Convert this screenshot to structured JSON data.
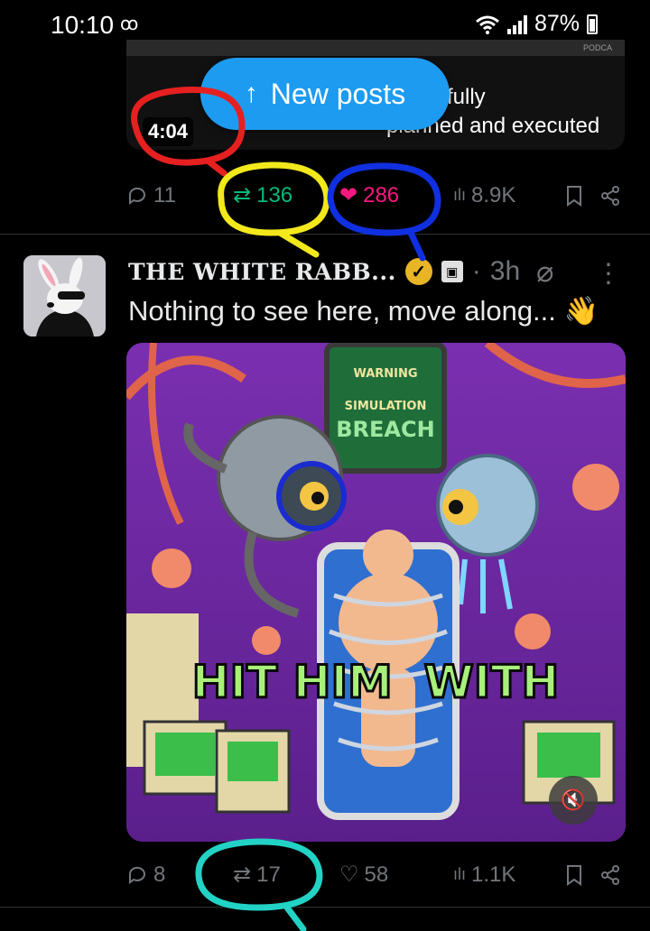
{
  "status_bar": {
    "time": "10:10",
    "voicemail": "ꝏ",
    "battery": "87%"
  },
  "previous_post": {
    "podcast_tag": "PODCA",
    "caption_line1": "fully",
    "caption_line2": "planned and executed",
    "duration": "4:04",
    "replies": "11",
    "reposts": "136",
    "likes": "286",
    "views": "8.9K"
  },
  "new_posts_pill": {
    "label": "New posts"
  },
  "post": {
    "author_name": "THE WHITE RABB...",
    "time_ago": "3h",
    "text": "Nothing to see here, move along... 👋",
    "media_texts": {
      "warning": "WARNING",
      "simulation": "SIMULATION",
      "breach": "BREACH",
      "overlay": "HIT HIM  WITH"
    },
    "replies": "8",
    "reposts": "17",
    "likes": "58",
    "views": "1.1K"
  },
  "annotations": {
    "red": "#e62020",
    "yellow": "#f2e81c",
    "blue": "#1030e0",
    "cyan": "#22d3c5"
  },
  "colors": {
    "accent": "#1d9bf0",
    "repost": "#00ba7c",
    "like": "#f91880",
    "muted": "#71767b"
  }
}
